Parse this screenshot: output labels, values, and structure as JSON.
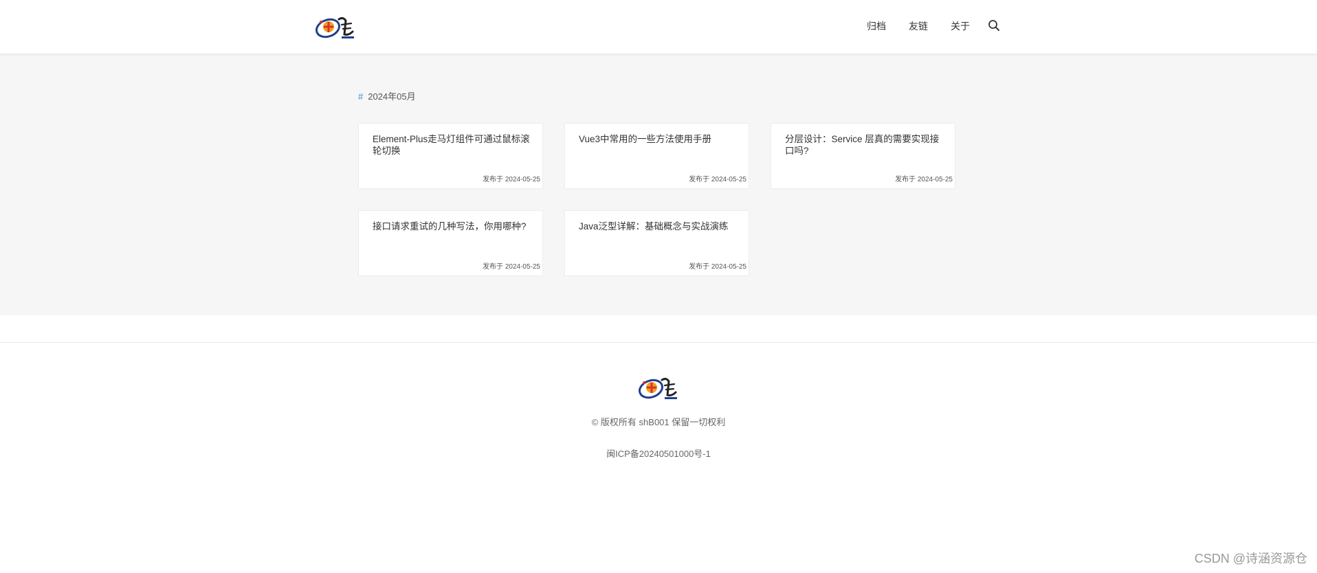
{
  "header": {
    "nav": [
      {
        "label": "归档",
        "icon": "none"
      },
      {
        "label": "友链",
        "icon": "none"
      },
      {
        "label": "关于",
        "icon": "none"
      }
    ],
    "search_icon": "search-icon"
  },
  "archive": {
    "hash": "#",
    "month": "2024年05月",
    "posts": [
      {
        "title": "Element-Plus走马灯组件可通过鼠标滚轮切换",
        "date": "发布于 2024-05-25"
      },
      {
        "title": "Vue3中常用的一些方法使用手册",
        "date": "发布于 2024-05-25"
      },
      {
        "title": "分层设计：Service 层真的需要实现接口吗?",
        "date": "发布于 2024-05-25"
      },
      {
        "title": "接口请求重试的几种写法，你用哪种?",
        "date": "发布于 2024-05-25"
      },
      {
        "title": "Java泛型详解：基础概念与实战演练",
        "date": "发布于 2024-05-25"
      }
    ]
  },
  "footer": {
    "copyright": "© 版权所有 shB001 保留一切权利",
    "icp": "闽ICP备20240501000号-1"
  },
  "watermark": "CSDN @诗涵资源仓",
  "colors": {
    "accent": "#3a8fd9",
    "main_bg": "#f6f6f6",
    "card_bg": "#ffffff",
    "logo_red": "#d8342a",
    "logo_blue": "#1f3f8f",
    "logo_orange": "#f0a020"
  }
}
